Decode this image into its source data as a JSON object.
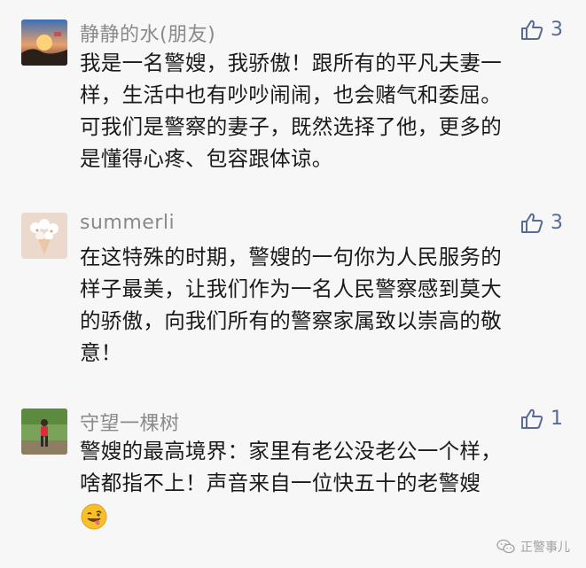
{
  "comments": [
    {
      "author": "静静的水(朋友)",
      "likes": "3",
      "lines": [
        "我是一名警嫂，我骄傲！跟所有的平凡夫妻一",
        "样，生活中也有吵吵闹闹，也会赌气和委屈。",
        "可我们是警察的妻子，既然选择了他，更多的",
        "是懂得心疼、包容跟体谅。"
      ]
    },
    {
      "author": "summerli",
      "likes": "3",
      "lines": [
        "在这特殊的时期，警嫂的一句你为人民服务的",
        "样子最美，让我们作为一名人民警察感到莫大",
        "的骄傲，向我们所有的警察家属致以崇高的敬",
        "意！"
      ]
    },
    {
      "author": "守望一棵树",
      "likes": "1",
      "lines": [
        "警嫂的最高境界：家里有老公没老公一个样，",
        "啥都指不上！声音来自一位快五十的老警嫂"
      ],
      "emoji": "grinning-tongue-emoji"
    }
  ],
  "watermark": {
    "text": "正警事儿",
    "icon": "wechat-icon"
  },
  "colors": {
    "background": "#f7f7f7",
    "link": "#576b95",
    "author": "#8a8a8a",
    "text": "#1a1a1a"
  }
}
